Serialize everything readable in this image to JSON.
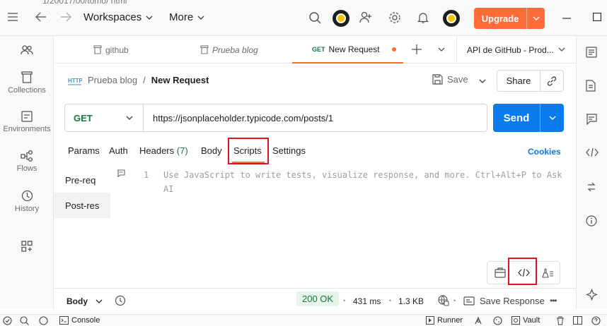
{
  "topbar": {
    "clipped_text": "1/20017/00/tomo/ html",
    "workspaces_label": "Workspaces",
    "more_label": "More",
    "upgrade_label": "Upgrade"
  },
  "tabs": [
    {
      "label": "github",
      "icon": "trash-icon"
    },
    {
      "label": "Prueba blog",
      "icon": "trash-icon"
    },
    {
      "method": "GET",
      "label": "New Request",
      "active": true
    },
    {
      "label": "API de GitHub - Prod..."
    }
  ],
  "sidebar": {
    "items": [
      {
        "label": "",
        "icon": "team-icon"
      },
      {
        "label": "Collections",
        "icon": "collections-icon"
      },
      {
        "label": "Environments",
        "icon": "environments-icon"
      },
      {
        "label": "Flows",
        "icon": "flows-icon"
      },
      {
        "label": "History",
        "icon": "history-icon"
      },
      {
        "label": "",
        "icon": "add-workspace-icon"
      }
    ]
  },
  "request": {
    "breadcrumb_parent": "Prueba blog",
    "breadcrumb_sep": "/",
    "title": "New Request",
    "save_label": "Save",
    "share_label": "Share",
    "method": "GET",
    "url": "https://jsonplaceholder.typicode.com/posts/1",
    "send_label": "Send"
  },
  "subtabs": {
    "params": "Params",
    "auth": "Auth",
    "headers": "Headers",
    "headers_count": "(7)",
    "body": "Body",
    "scripts": "Scripts",
    "settings": "Settings",
    "cookies": "Cookies"
  },
  "scripts": {
    "pre_req": "Pre-req",
    "post_res": "Post-res",
    "line_number": "1",
    "placeholder_line1": "Use JavaScript to write tests, visualize response, and more. Ctrl+Alt+P to Ask",
    "placeholder_line2": "AI"
  },
  "response": {
    "body_label": "Body",
    "status": "200 OK",
    "time": "431 ms",
    "size": "1.3 KB",
    "save_response": "Save Response",
    "more": "•••"
  },
  "footer": {
    "console": "Console",
    "runner": "Runner",
    "vault": "Vault"
  },
  "colors": {
    "accent": "#ff6c37",
    "send": "#097bed",
    "get": "#0f7c3b",
    "highlight": "#e0121f"
  }
}
